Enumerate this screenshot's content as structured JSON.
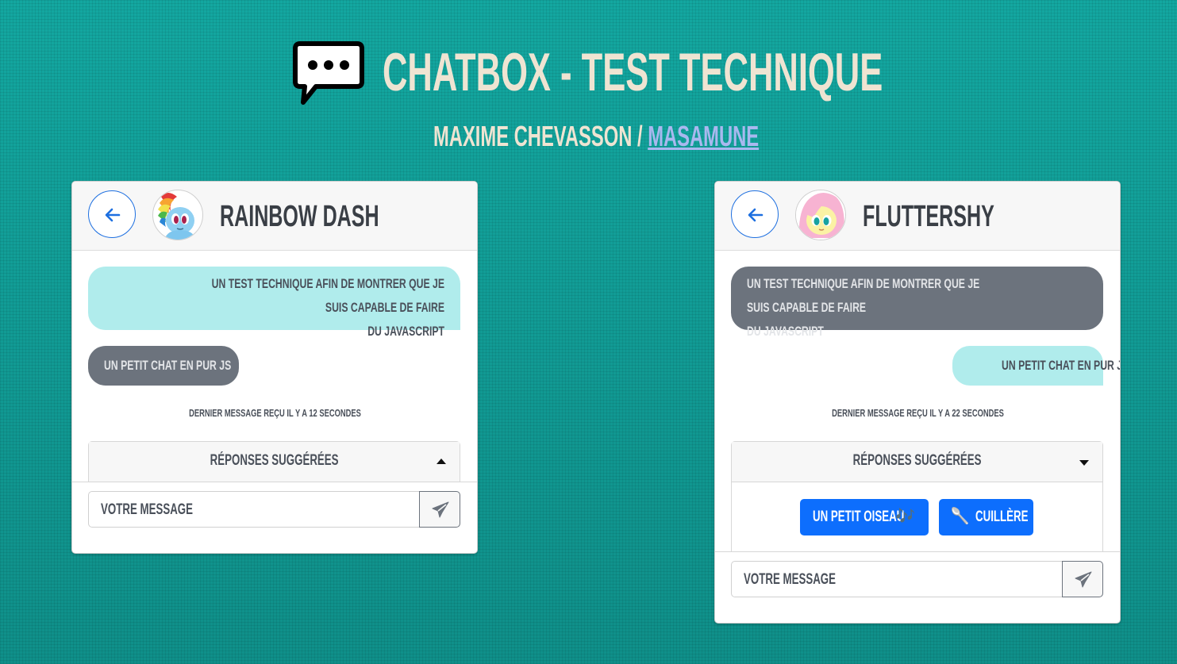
{
  "header": {
    "title": "CHATBOX - TEST TECHNIQUE",
    "icon": "chat-bubble-ellipsis-icon",
    "subtitle_author": "MAXIME CHEVASSON /",
    "subtitle_link": "MASAMUNE"
  },
  "colors": {
    "background": "#119a93",
    "title": "#efe4d2",
    "link": "#a9b8ef",
    "accent": "#0d6efd",
    "bubble_cyan": "#b0ecec",
    "bubble_gray": "#6c737d"
  },
  "chats": [
    {
      "name": "RAINBOW DASH",
      "avatar": "rainbow-dash-avatar",
      "messages": [
        {
          "text": "UN TEST TECHNIQUE AFIN DE MONTRER QUE JE SUIS CAPABLE DE FAIRE DU JAVASCRIPT",
          "line1": "UN TEST TECHNIQUE AFIN DE MONTRER QUE JE SUIS CAPABLE DE FAIRE",
          "line2": "DU JAVASCRIPT",
          "side": "sent"
        },
        {
          "text": "UN PETIT CHAT EN PUR JS",
          "side": "received"
        }
      ],
      "status": "DERNIER MESSAGE REÇU IL Y A 12 SECONDES",
      "suggestions_title": "RÉPONSES SUGGÉRÉES",
      "suggestions_expanded": false,
      "input_placeholder": "VOTRE MESSAGE"
    },
    {
      "name": "FLUTTERSHY",
      "avatar": "fluttershy-avatar",
      "messages": [
        {
          "text": "UN TEST TECHNIQUE AFIN DE MONTRER QUE JE SUIS CAPABLE DE FAIRE DU JAVASCRIPT",
          "line1": "UN TEST TECHNIQUE AFIN DE MONTRER QUE JE SUIS CAPABLE DE FAIRE",
          "line2": "DU JAVASCRIPT",
          "side": "received"
        },
        {
          "text": "UN PETIT CHAT EN PUR JS",
          "side": "sent"
        }
      ],
      "status": "DERNIER MESSAGE REÇU IL Y A 22 SECONDES",
      "suggestions_title": "RÉPONSES SUGGÉRÉES",
      "suggestions_expanded": true,
      "suggestions": [
        {
          "label": "UN PETIT OISEAU",
          "emoji": "🎶"
        },
        {
          "label": "CUILLÈRE",
          "emoji": "🥄"
        }
      ],
      "input_placeholder": "VOTRE MESSAGE"
    }
  ]
}
